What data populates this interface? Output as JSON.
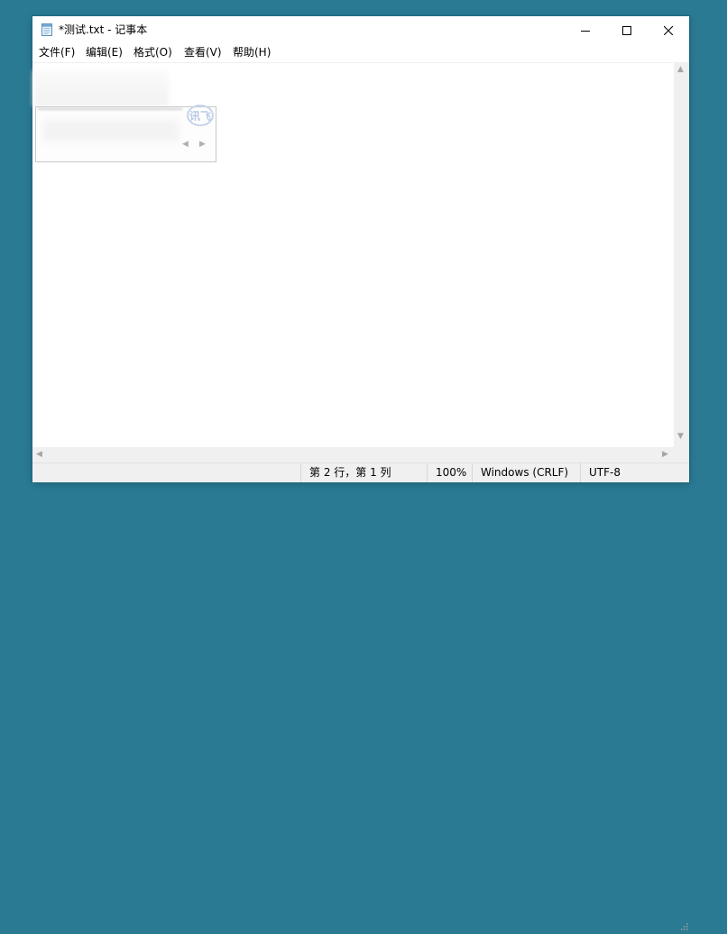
{
  "window": {
    "title": "*测试.txt - 记事本"
  },
  "menu": {
    "items": [
      {
        "label": "文件(F)"
      },
      {
        "label": "编辑(E)"
      },
      {
        "label": "格式(O)"
      },
      {
        "label": "查看(V)"
      },
      {
        "label": "帮助(H)"
      }
    ]
  },
  "editor": {
    "content": ""
  },
  "ime": {
    "logo_text": "讯飞"
  },
  "status": {
    "position": "第 2 行，第 1 列",
    "zoom": "100%",
    "line_ending": "Windows (CRLF)",
    "encoding": "UTF-8"
  },
  "icons": {
    "app": "notepad-icon",
    "minimize": "minimize-icon",
    "maximize": "maximize-icon",
    "close": "close-icon"
  },
  "colors": {
    "desktop": "#2a7a94",
    "statusbar": "#f0f0f0"
  }
}
